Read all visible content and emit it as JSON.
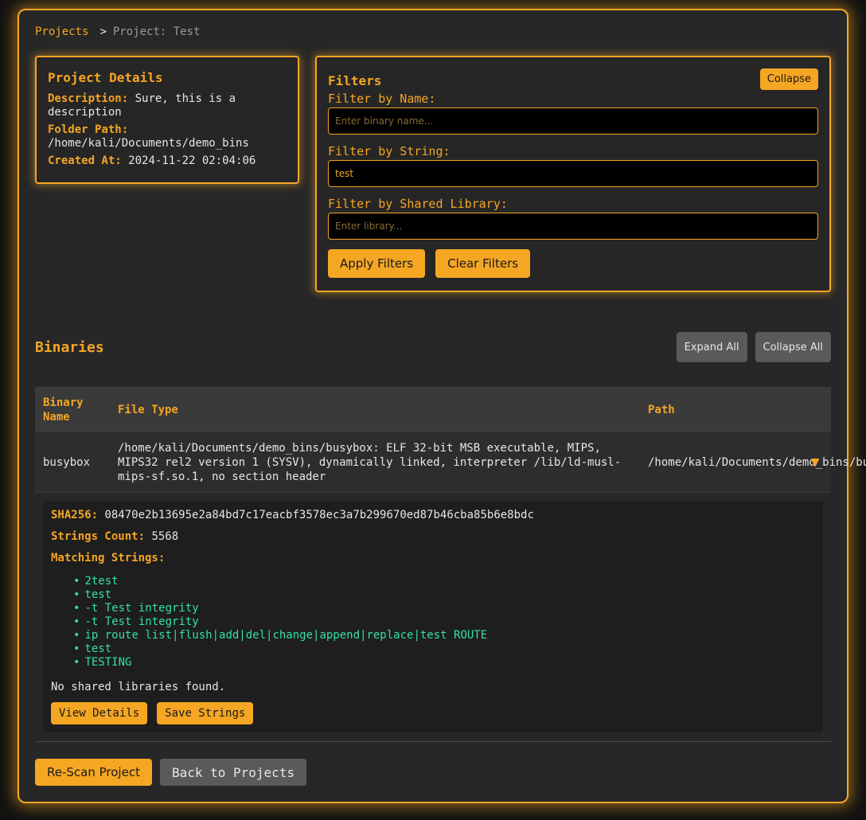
{
  "breadcrumb": {
    "root": "Projects",
    "separator": ">",
    "current": "Project: Test"
  },
  "details": {
    "title": "Project Details",
    "description_label": "Description:",
    "description": "Sure, this is a description",
    "folder_label": "Folder Path:",
    "folder": "/home/kali/Documents/demo_bins",
    "created_label": "Created At:",
    "created": "2024-11-22 02:04:06"
  },
  "filters": {
    "title": "Filters",
    "collapse_label": "Collapse",
    "name_label": "Filter by Name:",
    "name_placeholder": "Enter binary name...",
    "name_value": "",
    "string_label": "Filter by String:",
    "string_placeholder": "",
    "string_value": "test",
    "lib_label": "Filter by Shared Library:",
    "lib_placeholder": "Enter library...",
    "lib_value": "",
    "apply_label": "Apply Filters",
    "clear_label": "Clear Filters"
  },
  "binaries": {
    "title": "Binaries",
    "expand_all_label": "Expand All",
    "collapse_all_label": "Collapse All",
    "columns": [
      "Binary Name",
      "File Type",
      "Path"
    ],
    "rows": [
      {
        "name": "busybox",
        "file_type": "/home/kali/Documents/demo_bins/busybox: ELF 32-bit MSB executable, MIPS, MIPS32 rel2 version 1 (SYSV), dynamically linked, interpreter /lib/ld-musl-mips-sf.so.1, no section header",
        "path": "/home/kali/Documents/demo_bins/busybox",
        "toggle_icon": "▼"
      }
    ],
    "expanded": {
      "sha_label": "SHA256:",
      "sha": "08470e2b13695e2a84bd7c17eacbf3578ec3a7b299670ed87b46cba85b6e8bdc",
      "count_label": "Strings Count:",
      "count": "5568",
      "matching_label": "Matching Strings:",
      "strings": [
        "2test",
        "test",
        "-t Test integrity",
        "-t Test integrity",
        "ip route list|flush|add|del|change|append|replace|test ROUTE",
        "test",
        "TESTING"
      ],
      "no_libs": "No shared libraries found.",
      "view_label": "View Details",
      "save_label": "Save Strings"
    }
  },
  "footer": {
    "rescan_label": "Re-Scan Project",
    "back_label": "Back to Projects"
  },
  "colors": {
    "accent": "#f5a623",
    "match": "#34e0a1",
    "bg": "#272727"
  }
}
